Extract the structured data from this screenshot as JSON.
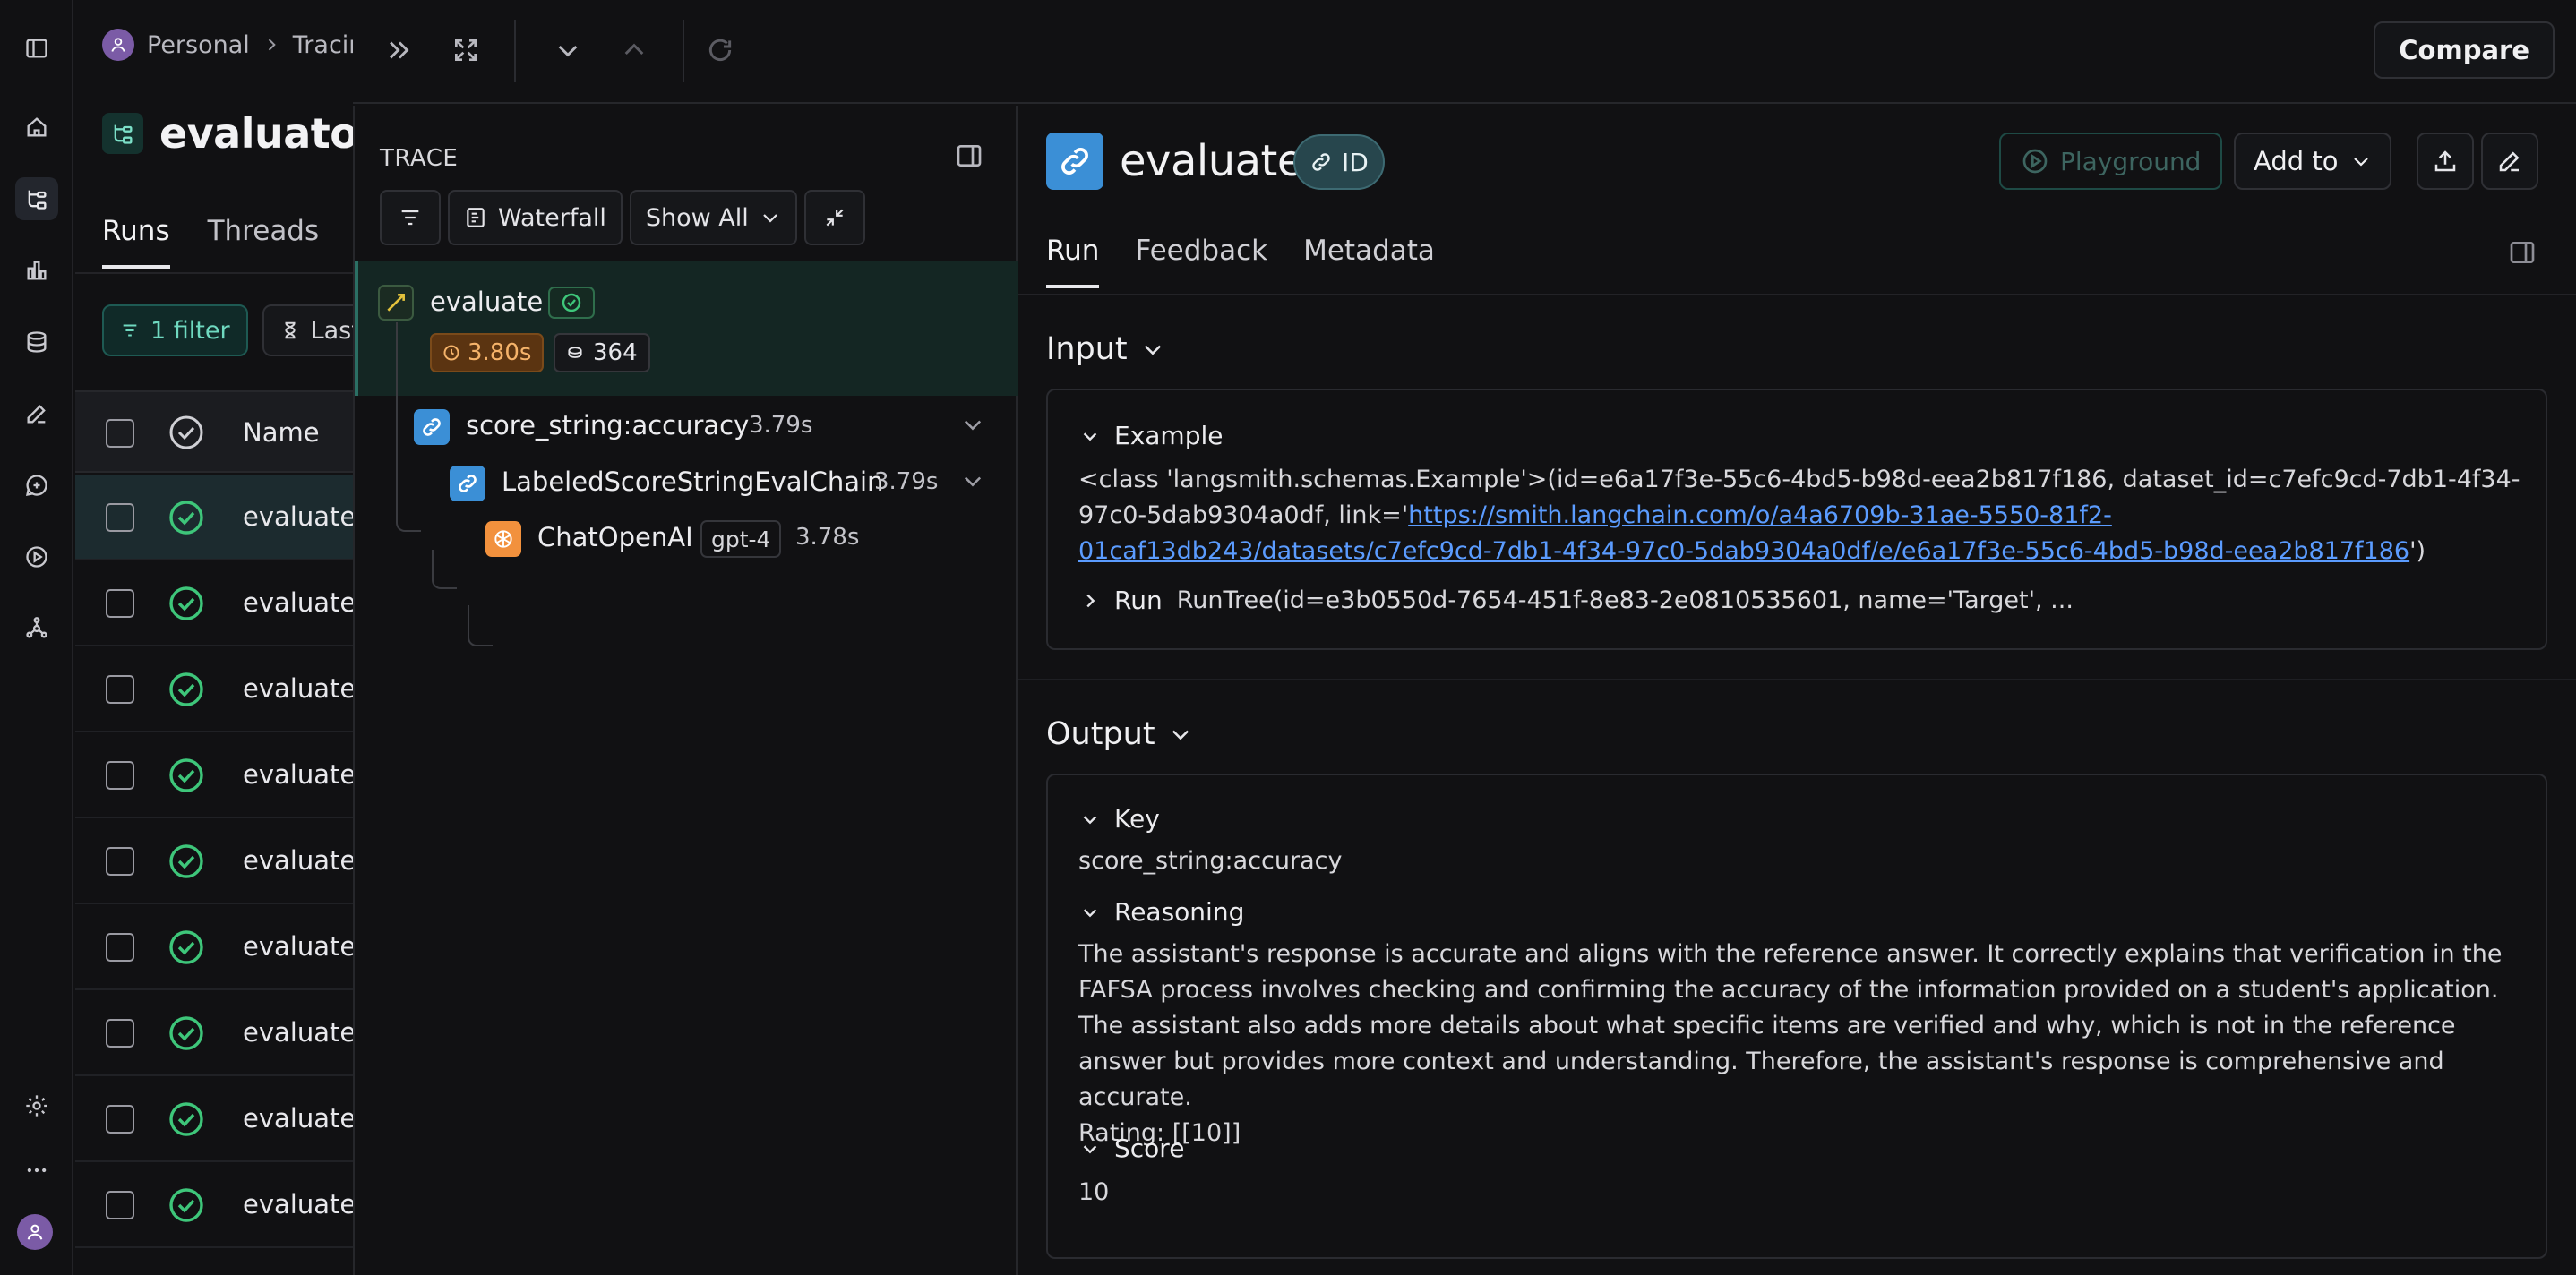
{
  "breadcrumb": {
    "workspace": "Personal",
    "section": "Tracing"
  },
  "project": {
    "name": "evaluators"
  },
  "runs_tabs": [
    "Runs",
    "Threads"
  ],
  "filters": {
    "filter_label": "1 filter",
    "time_label": "Last"
  },
  "runs_table": {
    "header_name": "Name",
    "rows": [
      "evaluate",
      "evaluate",
      "evaluate",
      "evaluate",
      "evaluate",
      "evaluate",
      "evaluate",
      "evaluate",
      "evaluate"
    ]
  },
  "topbar": {
    "compare_label": "Compare"
  },
  "trace": {
    "title": "TRACE",
    "waterfall_label": "Waterfall",
    "show_all_label": "Show All",
    "root": {
      "name": "evaluate",
      "latency": "3.80s",
      "tokens": "364"
    },
    "children": [
      {
        "name": "score_string:accuracy",
        "time": "3.79s"
      },
      {
        "name": "LabeledScoreStringEvalChain",
        "time": "3.79s"
      },
      {
        "name": "ChatOpenAI",
        "tag": "gpt-4",
        "time": "3.78s"
      }
    ]
  },
  "detail": {
    "title": "evaluate",
    "id_label": "ID",
    "playground_label": "Playground",
    "add_to_label": "Add to",
    "tabs": [
      "Run",
      "Feedback",
      "Metadata"
    ],
    "input": {
      "heading": "Input",
      "example_label": "Example",
      "example_prefix": "<class 'langsmith.schemas.Example'>(id=e6a17f3e-55c6-4bd5-b98d-eea2b817f186, dataset_id=c7efc9cd-7db1-4f34-97c0-5dab9304a0df, link='",
      "example_link": "https://smith.langchain.com/o/a4a6709b-31ae-5550-81f2-01caf13db243/datasets/c7efc9cd-7db1-4f34-97c0-5dab9304a0df/e/e6a17f3e-55c6-4bd5-b98d-eea2b817f186",
      "example_suffix": "')",
      "run_label": "Run",
      "run_value": "RunTree(id=e3b0550d-7654-451f-8e83-2e0810535601, name='Target', ..."
    },
    "output": {
      "heading": "Output",
      "key_label": "Key",
      "key_value": "score_string:accuracy",
      "reasoning_label": "Reasoning",
      "reasoning_value": "The assistant's response is accurate and aligns with the reference answer. It correctly explains that verification in the FAFSA process involves checking and confirming the accuracy of the information provided on a student's application. The assistant also adds more details about what specific items are verified and why, which is not in the reference answer but provides more context and understanding. Therefore, the assistant's response is comprehensive and accurate.",
      "rating_value": "Rating: [[10]]",
      "score_label": "Score",
      "score_value": "10"
    }
  },
  "colors": {
    "accent_teal": "#6fd9c0",
    "link_blue": "#5b9cff",
    "status_green": "#3ec67a",
    "latency_orange": "#f5b36a",
    "chain_blue": "#3b8fd6",
    "openai_orange": "#f2913d"
  }
}
